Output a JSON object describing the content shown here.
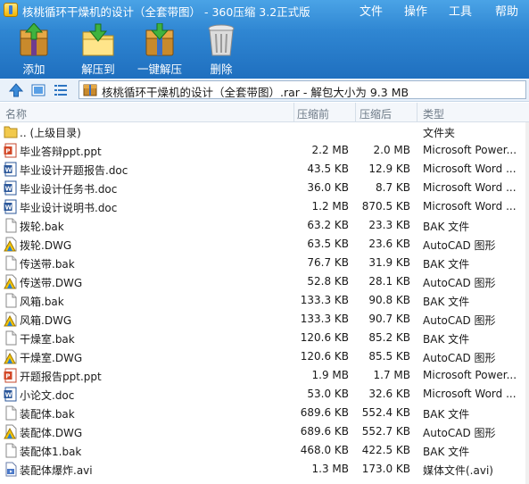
{
  "window": {
    "title": "核桃循环干燥机的设计（全套带图） - 360压缩 3.2正式版"
  },
  "menu": {
    "file": "文件",
    "operation": "操作",
    "tools": "工具",
    "help": "帮助"
  },
  "toolbar": {
    "add_label": "添加",
    "extract_label": "解压到",
    "one_click_label": "一键解压",
    "delete_label": "删除"
  },
  "address": {
    "path": "核桃循环干燥机的设计（全套带图）.rar - 解包大小为 9.3 MB"
  },
  "columns": {
    "name": "名称",
    "compressed_before": "压缩前",
    "compressed_after": "压缩后",
    "type": "类型"
  },
  "files": [
    {
      "name": ".. (上级目录)",
      "before": "",
      "after": "",
      "type": "文件夹",
      "icon": "folder-icon"
    },
    {
      "name": "毕业答辩ppt.ppt",
      "before": "2.2 MB",
      "after": "2.0 MB",
      "type": "Microsoft Power...",
      "icon": "ppt-icon"
    },
    {
      "name": "毕业设计开题报告.doc",
      "before": "43.5 KB",
      "after": "12.9 KB",
      "type": "Microsoft Word ...",
      "icon": "word-icon"
    },
    {
      "name": "毕业设计任务书.doc",
      "before": "36.0 KB",
      "after": "8.7 KB",
      "type": "Microsoft Word ...",
      "icon": "word-icon"
    },
    {
      "name": "毕业设计说明书.doc",
      "before": "1.2 MB",
      "after": "870.5 KB",
      "type": "Microsoft Word ...",
      "icon": "word-icon"
    },
    {
      "name": "拨轮.bak",
      "before": "63.2 KB",
      "after": "23.3 KB",
      "type": "BAK 文件",
      "icon": "file-icon"
    },
    {
      "name": "拨轮.DWG",
      "before": "63.5 KB",
      "after": "23.6 KB",
      "type": "AutoCAD 图形",
      "icon": "dwg-icon"
    },
    {
      "name": "传送带.bak",
      "before": "76.7 KB",
      "after": "31.9 KB",
      "type": "BAK 文件",
      "icon": "file-icon"
    },
    {
      "name": "传送带.DWG",
      "before": "52.8 KB",
      "after": "28.1 KB",
      "type": "AutoCAD 图形",
      "icon": "dwg-icon"
    },
    {
      "name": "风箱.bak",
      "before": "133.3 KB",
      "after": "90.8 KB",
      "type": "BAK 文件",
      "icon": "file-icon"
    },
    {
      "name": "风箱.DWG",
      "before": "133.3 KB",
      "after": "90.7 KB",
      "type": "AutoCAD 图形",
      "icon": "dwg-icon"
    },
    {
      "name": "干燥室.bak",
      "before": "120.6 KB",
      "after": "85.2 KB",
      "type": "BAK 文件",
      "icon": "file-icon"
    },
    {
      "name": "干燥室.DWG",
      "before": "120.6 KB",
      "after": "85.5 KB",
      "type": "AutoCAD 图形",
      "icon": "dwg-icon"
    },
    {
      "name": "开题报告ppt.ppt",
      "before": "1.9 MB",
      "after": "1.7 MB",
      "type": "Microsoft Power...",
      "icon": "ppt-icon"
    },
    {
      "name": "小论文.doc",
      "before": "53.0 KB",
      "after": "32.6 KB",
      "type": "Microsoft Word ...",
      "icon": "word-icon"
    },
    {
      "name": "装配体.bak",
      "before": "689.6 KB",
      "after": "552.4 KB",
      "type": "BAK 文件",
      "icon": "file-icon"
    },
    {
      "name": "装配体.DWG",
      "before": "689.6 KB",
      "after": "552.7 KB",
      "type": "AutoCAD 图形",
      "icon": "dwg-icon"
    },
    {
      "name": "装配体1.bak",
      "before": "468.0 KB",
      "after": "422.5 KB",
      "type": "BAK 文件",
      "icon": "file-icon"
    },
    {
      "name": "装配体爆炸.avi",
      "before": "1.3 MB",
      "after": "173.0 KB",
      "type": "媒体文件(.avi)",
      "icon": "video-icon"
    }
  ]
}
